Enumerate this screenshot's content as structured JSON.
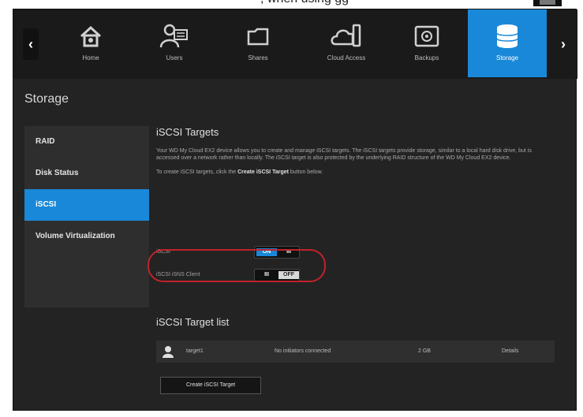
{
  "nav": {
    "items": [
      {
        "label": "Home",
        "icon": "home-icon"
      },
      {
        "label": "Users",
        "icon": "users-icon"
      },
      {
        "label": "Shares",
        "icon": "shares-icon"
      },
      {
        "label": "Cloud Access",
        "icon": "cloud-access-icon"
      },
      {
        "label": "Backups",
        "icon": "backups-icon"
      },
      {
        "label": "Storage",
        "icon": "storage-icon",
        "active": true
      }
    ],
    "prev_arrow": "‹",
    "next_arrow": "›"
  },
  "page_title": "Storage",
  "sidebar": {
    "items": [
      {
        "label": "RAID"
      },
      {
        "label": "Disk Status"
      },
      {
        "label": "iSCSI",
        "active": true
      },
      {
        "label": "Volume Virtualization"
      }
    ]
  },
  "iscsi": {
    "heading": "iSCSI Targets",
    "description": "Your WD My Cloud EX2 device allows you to create and manage iSCSI targets. The iSCSI targets provide storage, similar to a local hard disk drive, but is accessed over a network rather than locally. The iSCSI target is also protected by the underlying RAID structure of the WD My Cloud EX2 device.",
    "instruction_prefix": "To create iSCSI targets, click the ",
    "instruction_bold": "Create iSCSI Target",
    "instruction_suffix": " button below.",
    "settings": [
      {
        "label": "iSCSI",
        "on_text": "ON",
        "off_text": "III",
        "state": "on"
      },
      {
        "label": "iSCSI iSNS Client",
        "on_text": "III",
        "off_text": "OFF",
        "state": "off"
      }
    ]
  },
  "target_list": {
    "title": "iSCSI Target list",
    "row": {
      "icon": "user-icon",
      "name": "target1",
      "status": "No initiators connected",
      "size": "2 GB",
      "detail": "Details"
    },
    "create_button": "Create iSCSI Target"
  },
  "top_strip_text": ", when using gg",
  "colors": {
    "accent": "#1a88d8",
    "highlight": "#c0232b",
    "background": "#232323"
  }
}
